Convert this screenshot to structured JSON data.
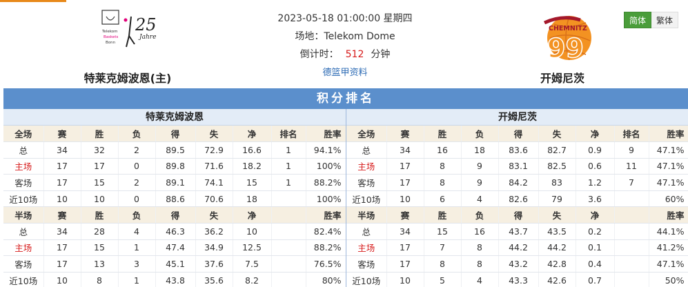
{
  "header": {
    "datetime": "2023-05-18 01:00:00 星期四",
    "venue": "场地：Telekom Dome",
    "countdown_label": "倒计时：",
    "countdown_value": "512",
    "countdown_unit": "分钟",
    "league_link": "德篮甲资料",
    "home_team": "特莱克姆波恩(主)",
    "away_team": "开姆尼茨",
    "home_logo_text": "Telekom Baskets Bonn 25 Jahre",
    "away_logo_text": "CHEMNITZ 99"
  },
  "lang": {
    "simplified": "简体",
    "traditional": "繁体"
  },
  "title": "积分排名",
  "colors": {
    "title_bar": "#5b8fcc",
    "header_row": "#f6efe1",
    "highlight": "#d61818",
    "lang_active": "#4a9d3a"
  },
  "home": {
    "name": "特莱克姆波恩",
    "full_header": [
      "全场",
      "赛",
      "胜",
      "负",
      "得",
      "失",
      "净",
      "排名",
      "胜率"
    ],
    "full_rows": [
      [
        "总",
        "34",
        "32",
        "2",
        "89.5",
        "72.9",
        "16.6",
        "1",
        "94.1%"
      ],
      [
        "主场",
        "17",
        "17",
        "0",
        "89.8",
        "71.6",
        "18.2",
        "1",
        "100%"
      ],
      [
        "客场",
        "17",
        "15",
        "2",
        "89.1",
        "74.1",
        "15",
        "1",
        "88.2%"
      ],
      [
        "近10场",
        "10",
        "10",
        "0",
        "88.6",
        "70.6",
        "18",
        "",
        "100%"
      ]
    ],
    "half_header": [
      "半场",
      "赛",
      "胜",
      "负",
      "得",
      "失",
      "净",
      "",
      "胜率"
    ],
    "half_rows": [
      [
        "总",
        "34",
        "28",
        "4",
        "46.3",
        "36.2",
        "10",
        "",
        "82.4%"
      ],
      [
        "主场",
        "17",
        "15",
        "1",
        "47.4",
        "34.9",
        "12.5",
        "",
        "88.2%"
      ],
      [
        "客场",
        "17",
        "13",
        "3",
        "45.1",
        "37.6",
        "7.5",
        "",
        "76.5%"
      ],
      [
        "近10场",
        "10",
        "8",
        "1",
        "43.8",
        "35.6",
        "8.2",
        "",
        "80%"
      ]
    ]
  },
  "away": {
    "name": "开姆尼茨",
    "full_header": [
      "全场",
      "赛",
      "胜",
      "负",
      "得",
      "失",
      "净",
      "排名",
      "胜率"
    ],
    "full_rows": [
      [
        "总",
        "34",
        "16",
        "18",
        "83.6",
        "82.7",
        "0.9",
        "9",
        "47.1%"
      ],
      [
        "主场",
        "17",
        "8",
        "9",
        "83.1",
        "82.5",
        "0.6",
        "11",
        "47.1%"
      ],
      [
        "客场",
        "17",
        "8",
        "9",
        "84.2",
        "83",
        "1.2",
        "7",
        "47.1%"
      ],
      [
        "近10场",
        "10",
        "6",
        "4",
        "82.6",
        "79",
        "3.6",
        "",
        "60%"
      ]
    ],
    "half_header": [
      "半场",
      "赛",
      "胜",
      "负",
      "得",
      "失",
      "净",
      "",
      "胜率"
    ],
    "half_rows": [
      [
        "总",
        "34",
        "15",
        "16",
        "43.7",
        "43.5",
        "0.2",
        "",
        "44.1%"
      ],
      [
        "主场",
        "17",
        "7",
        "8",
        "44.2",
        "44.2",
        "0.1",
        "",
        "41.2%"
      ],
      [
        "客场",
        "17",
        "8",
        "8",
        "43.2",
        "42.8",
        "0.4",
        "",
        "47.1%"
      ],
      [
        "近10场",
        "10",
        "5",
        "4",
        "43.3",
        "42.6",
        "0.7",
        "",
        "50%"
      ]
    ]
  }
}
